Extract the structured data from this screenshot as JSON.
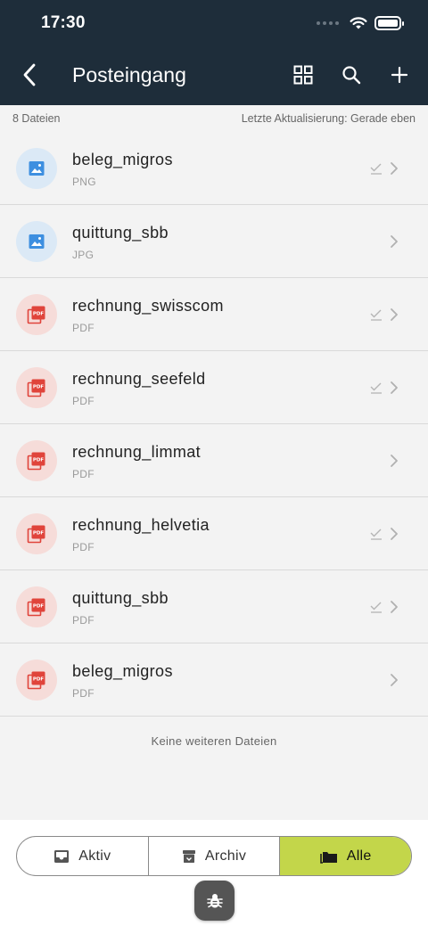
{
  "status_bar": {
    "time": "17:30"
  },
  "nav": {
    "title": "Posteingang"
  },
  "meta": {
    "file_count": "8 Dateien",
    "last_update": "Letzte Aktualisierung: Gerade eben"
  },
  "files": [
    {
      "name": "beleg_migros",
      "type": "PNG",
      "kind": "image",
      "checked": true
    },
    {
      "name": "quittung_sbb",
      "type": "JPG",
      "kind": "image",
      "checked": false
    },
    {
      "name": "rechnung_swisscom",
      "type": "PDF",
      "kind": "pdf",
      "checked": true
    },
    {
      "name": "rechnung_seefeld",
      "type": "PDF",
      "kind": "pdf",
      "checked": true
    },
    {
      "name": "rechnung_limmat",
      "type": "PDF",
      "kind": "pdf",
      "checked": false
    },
    {
      "name": "rechnung_helvetia",
      "type": "PDF",
      "kind": "pdf",
      "checked": true
    },
    {
      "name": "quittung_sbb",
      "type": "PDF",
      "kind": "pdf",
      "checked": true
    },
    {
      "name": "beleg_migros",
      "type": "PDF",
      "kind": "pdf",
      "checked": false
    }
  ],
  "empty_note": "Keine weiteren Dateien",
  "segments": [
    {
      "label": "Aktiv",
      "icon": "inbox-icon",
      "active": false
    },
    {
      "label": "Archiv",
      "icon": "archive-icon",
      "active": false
    },
    {
      "label": "Alle",
      "icon": "folder-icon",
      "active": true
    }
  ],
  "colors": {
    "header_bg": "#1e2d3a",
    "accent": "#c3d64a",
    "pdf_red": "#e0443b",
    "image_blue": "#3d8fe0"
  },
  "icons": {
    "back": "chevron-left-icon",
    "grid": "grid-icon",
    "search": "search-icon",
    "add": "plus-icon",
    "debug": "bug-icon"
  }
}
